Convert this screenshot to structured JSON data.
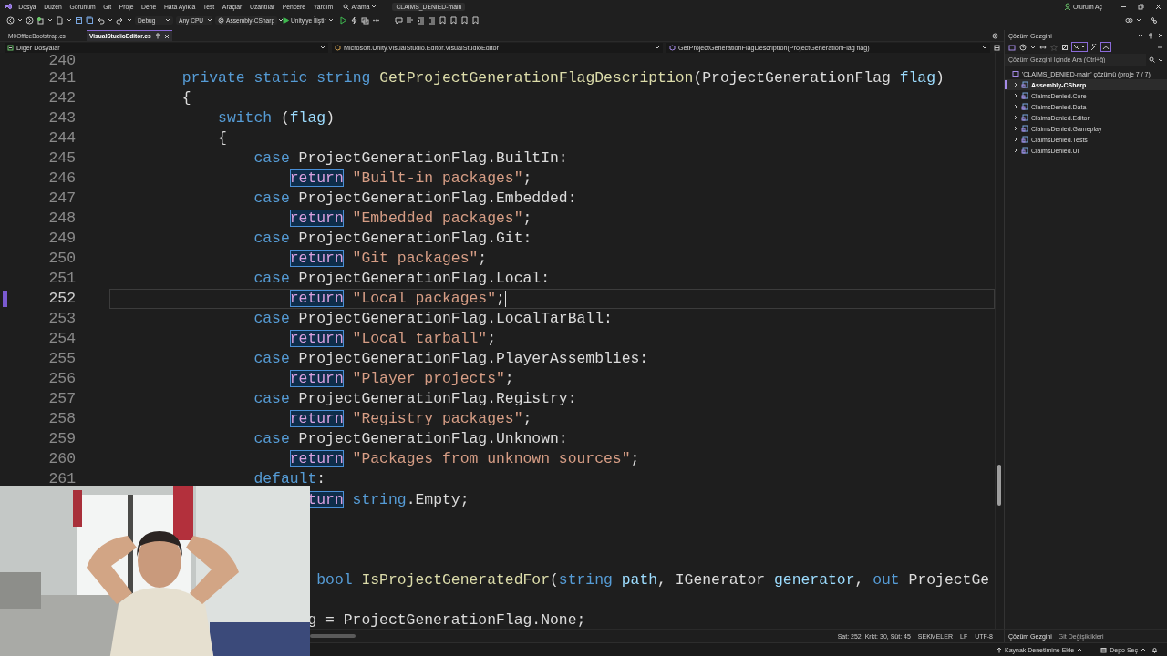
{
  "title_bar": {
    "menu": [
      "Dosya",
      "Düzen",
      "Görünüm",
      "Git",
      "Proje",
      "Derle",
      "Hata Ayıkla",
      "Test",
      "Araçlar",
      "Uzantılar",
      "Pencere",
      "Yardım"
    ],
    "search": "Arama",
    "solution_name": "CLAIMS_DENIED-main",
    "sign_in": "Oturum Aç"
  },
  "toolbar": {
    "configuration": "Debug",
    "platform": "Any CPU",
    "startup_project": "Assembly-CSharp",
    "attach": "Unity'ye İliştir"
  },
  "tabs": [
    {
      "label": "M0OfficeBootstrap.cs",
      "selected": false
    },
    {
      "label": "VisualStudioEditor.cs",
      "selected": true
    }
  ],
  "navigation": {
    "project": "Diğer Dosyalar",
    "type": "Microsoft.Unity.VisualStudio.Editor.VisualStudioEditor",
    "member": "GetProjectGenerationFlagDescription(ProjectGenerationFlag flag)"
  },
  "editor": {
    "lines": [
      {
        "number": "240",
        "current": false
      },
      {
        "number": "241",
        "current": false,
        "tokens": [
          {
            "kind": "keyword",
            "text": "        private"
          },
          {
            "kind": "keyword",
            "text": " static"
          },
          {
            "kind": "keyword",
            "text": " string"
          },
          {
            "kind": "method",
            "text": " GetProjectGenerationFlagDescription"
          },
          {
            "kind": "plain",
            "text": "(ProjectGenerationFlag"
          },
          {
            "kind": "param",
            "text": " flag"
          },
          {
            "kind": "plain",
            "text": ")"
          }
        ]
      },
      {
        "number": "242",
        "current": false,
        "tokens": [
          {
            "kind": "plain",
            "text": "        {"
          }
        ]
      },
      {
        "number": "243",
        "current": false,
        "tokens": [
          {
            "kind": "keyword",
            "text": "            switch"
          },
          {
            "kind": "plain",
            "text": " ("
          },
          {
            "kind": "param",
            "text": "flag"
          },
          {
            "kind": "plain",
            "text": ")"
          }
        ]
      },
      {
        "number": "244",
        "current": false,
        "tokens": [
          {
            "kind": "plain",
            "text": "            {"
          }
        ]
      },
      {
        "number": "245",
        "current": false,
        "tokens": [
          {
            "kind": "keyword",
            "text": "                case"
          },
          {
            "kind": "plain",
            "text": " ProjectGenerationFlag.BuiltIn:"
          }
        ]
      },
      {
        "number": "246",
        "current": false,
        "tokens": [
          {
            "kind": "highlight",
            "text": "                    return"
          },
          {
            "kind": "string",
            "text": " \"Built-in packages\""
          },
          {
            "kind": "plain",
            "text": ";"
          }
        ]
      },
      {
        "number": "247",
        "current": false,
        "tokens": [
          {
            "kind": "keyword",
            "text": "                case"
          },
          {
            "kind": "plain",
            "text": " ProjectGenerationFlag.Embedded:"
          }
        ]
      },
      {
        "number": "248",
        "current": false,
        "tokens": [
          {
            "kind": "highlight",
            "text": "                    return"
          },
          {
            "kind": "string",
            "text": " \"Embedded packages\""
          },
          {
            "kind": "plain",
            "text": ";"
          }
        ]
      },
      {
        "number": "249",
        "current": false,
        "tokens": [
          {
            "kind": "keyword",
            "text": "                case"
          },
          {
            "kind": "plain",
            "text": " ProjectGenerationFlag.Git:"
          }
        ]
      },
      {
        "number": "250",
        "current": false,
        "tokens": [
          {
            "kind": "highlight",
            "text": "                    return"
          },
          {
            "kind": "string",
            "text": " \"Git packages\""
          },
          {
            "kind": "plain",
            "text": ";"
          }
        ]
      },
      {
        "number": "251",
        "current": false,
        "tokens": [
          {
            "kind": "keyword",
            "text": "                case"
          },
          {
            "kind": "plain",
            "text": " ProjectGenerationFlag.Local:"
          }
        ]
      },
      {
        "number": "252",
        "current": true,
        "tokens": [
          {
            "kind": "highlight",
            "text": "                    return"
          },
          {
            "kind": "string",
            "text": " \"Local packages\""
          },
          {
            "kind": "plain",
            "text": ";"
          }
        ]
      },
      {
        "number": "253",
        "current": false,
        "tokens": [
          {
            "kind": "keyword",
            "text": "                case"
          },
          {
            "kind": "plain",
            "text": " ProjectGenerationFlag.LocalTarBall:"
          }
        ]
      },
      {
        "number": "254",
        "current": false,
        "tokens": [
          {
            "kind": "highlight",
            "text": "                    return"
          },
          {
            "kind": "string",
            "text": " \"Local tarball\""
          },
          {
            "kind": "plain",
            "text": ";"
          }
        ]
      },
      {
        "number": "255",
        "current": false,
        "tokens": [
          {
            "kind": "keyword",
            "text": "                case"
          },
          {
            "kind": "plain",
            "text": " ProjectGenerationFlag.PlayerAssemblies:"
          }
        ]
      },
      {
        "number": "256",
        "current": false,
        "tokens": [
          {
            "kind": "highlight",
            "text": "                    return"
          },
          {
            "kind": "string",
            "text": " \"Player projects\""
          },
          {
            "kind": "plain",
            "text": ";"
          }
        ]
      },
      {
        "number": "257",
        "current": false,
        "tokens": [
          {
            "kind": "keyword",
            "text": "                case"
          },
          {
            "kind": "plain",
            "text": " ProjectGenerationFlag.Registry:"
          }
        ]
      },
      {
        "number": "258",
        "current": false,
        "tokens": [
          {
            "kind": "highlight",
            "text": "                    return"
          },
          {
            "kind": "string",
            "text": " \"Registry packages\""
          },
          {
            "kind": "plain",
            "text": ";"
          }
        ]
      },
      {
        "number": "259",
        "current": false,
        "tokens": [
          {
            "kind": "keyword",
            "text": "                case"
          },
          {
            "kind": "plain",
            "text": " ProjectGenerationFlag.Unknown:"
          }
        ]
      },
      {
        "number": "260",
        "current": false,
        "tokens": [
          {
            "kind": "highlight",
            "text": "                    return"
          },
          {
            "kind": "string",
            "text": " \"Packages from unknown sources\""
          },
          {
            "kind": "plain",
            "text": ";"
          }
        ]
      },
      {
        "number": "261",
        "current": false,
        "tokens": [
          {
            "kind": "keyword",
            "text": "                default"
          },
          {
            "kind": "plain",
            "text": ":"
          }
        ]
      },
      {
        "current": false,
        "tokens": [
          {
            "kind": "highlight",
            "text": "                      turn"
          },
          {
            "kind": "keyword",
            "text": " string"
          },
          {
            "kind": "plain",
            "text": ".Empty;"
          }
        ]
      },
      {
        "current": false
      },
      {
        "current": false
      },
      {
        "current": false
      },
      {
        "current": false,
        "tokens": [
          {
            "kind": "keyword",
            "text": "                       bool"
          },
          {
            "kind": "method",
            "text": " IsProjectGeneratedFor"
          },
          {
            "kind": "plain",
            "text": "("
          },
          {
            "kind": "keyword",
            "text": "string"
          },
          {
            "kind": "param",
            "text": " path"
          },
          {
            "kind": "plain",
            "text": ", IGenerator"
          },
          {
            "kind": "param",
            "text": " generator"
          },
          {
            "kind": "plain",
            "text": ","
          },
          {
            "kind": "keyword",
            "text": " out"
          },
          {
            "kind": "plain",
            "text": " ProjectGe"
          }
        ]
      },
      {
        "current": false
      },
      {
        "current": false,
        "tokens": [
          {
            "kind": "plain",
            "text": "                      g = ProjectGenerationFlag.None;"
          }
        ]
      }
    ]
  },
  "editor_status": {
    "position": "Sat: 252, Krkt: 30, Süt: 45",
    "indentation": "SEKMELER",
    "line_ending": "LF",
    "encoding": "UTF-8"
  },
  "solution_explorer": {
    "title": "Çözüm Gezgini",
    "search_placeholder": "Çözüm Gezgini İçinde Ara (Ctrl+ğ)",
    "solution": "'CLAIMS_DENIED-main' çözümü (proje 7 / 7)",
    "projects": [
      {
        "label": "Assembly-CSharp",
        "selected": true,
        "expanded": false
      },
      {
        "label": "ClaimsDenied.Core",
        "selected": false,
        "expanded": false
      },
      {
        "label": "ClaimsDenied.Data",
        "selected": false,
        "expanded": false
      },
      {
        "label": "ClaimsDenied.Editor",
        "selected": false,
        "expanded": false
      },
      {
        "label": "ClaimsDenied.Gameplay",
        "selected": false,
        "expanded": false
      },
      {
        "label": "ClaimsDenied.Tests",
        "selected": false,
        "expanded": false
      },
      {
        "label": "ClaimsDenied.UI",
        "selected": false,
        "expanded": false
      }
    ]
  },
  "panel_tabs": [
    {
      "label": "Çözüm Gezgini",
      "selected": true
    },
    {
      "label": "Git Değişiklikleri",
      "selected": false
    }
  ],
  "status_bar": {
    "source_control": "Kaynak Denetimine Ekle",
    "repository": "Depo Seç"
  }
}
